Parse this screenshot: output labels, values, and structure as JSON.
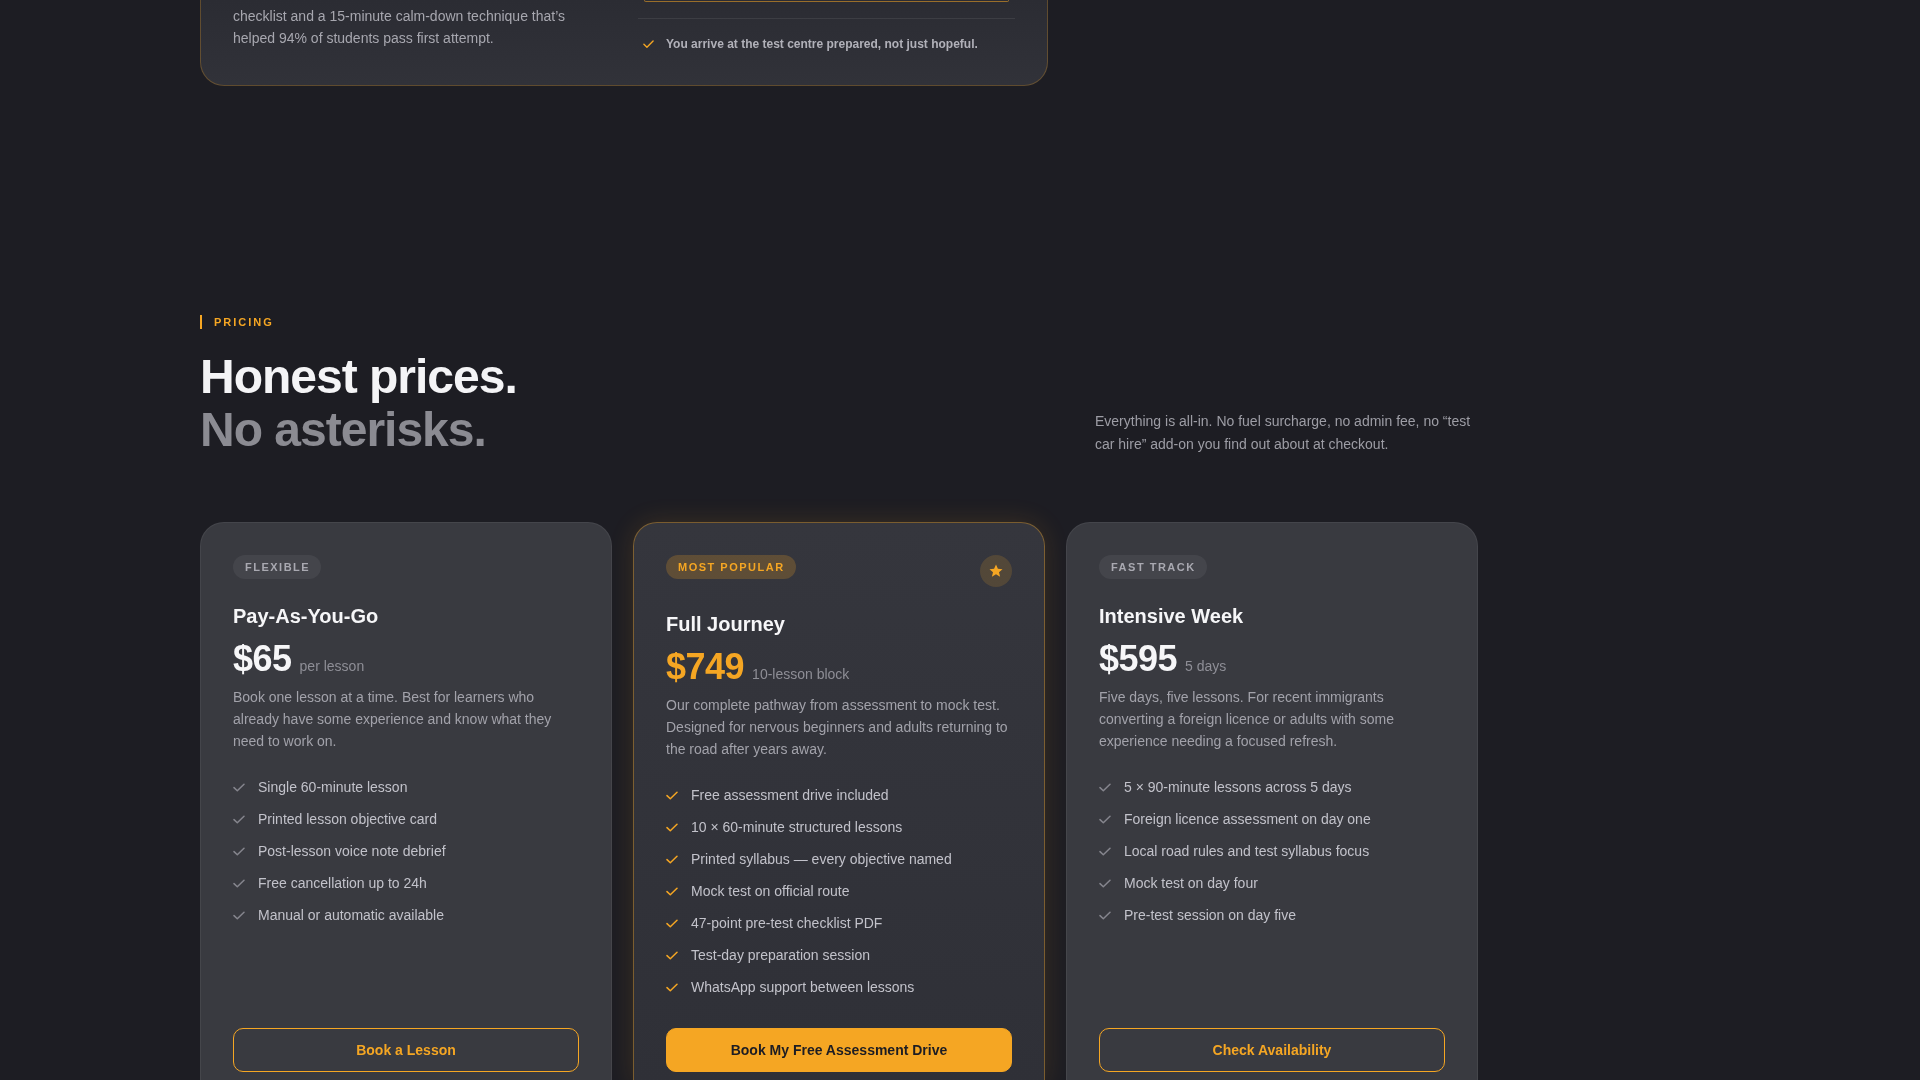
{
  "intro_card": {
    "description": "checklist and a 15-minute calm-down technique that’s helped 94% of students pass first attempt.",
    "promise": "You arrive at the test centre prepared, not just hopeful."
  },
  "pricing": {
    "eyebrow": "PRICING",
    "heading": "Honest prices.",
    "subheading": "No asterisks.",
    "note": "Everything is all-in. No fuel surcharge, no admin fee, no “test car hire” add-on you find out about at checkout."
  },
  "plans": [
    {
      "badge": "FLEXIBLE",
      "featured": false,
      "name": "Pay-As-You-Go",
      "price": "$65",
      "unit": "per lesson",
      "description": "Book one lesson at a time. Best for learners who already have some experience and know what they need to work on.",
      "features": [
        "Single 60-minute lesson",
        "Printed lesson objective card",
        "Post-lesson voice note debrief",
        "Free cancellation up to 24h",
        "Manual or automatic available"
      ],
      "button": "Book a Lesson"
    },
    {
      "badge": "MOST POPULAR",
      "featured": true,
      "name": "Full Journey",
      "price": "$749",
      "unit": "10-lesson block",
      "description": "Our complete pathway from assessment to mock test. Designed for nervous beginners and adults returning to the road after years away.",
      "features": [
        "Free assessment drive included",
        "10 × 60-minute structured lessons",
        "Printed syllabus — every objective named",
        "Mock test on official route",
        "47-point pre-test checklist PDF",
        "Test-day preparation session",
        "WhatsApp support between lessons"
      ],
      "button": "Book My Free Assessment Drive"
    },
    {
      "badge": "FAST TRACK",
      "featured": false,
      "name": "Intensive Week",
      "price": "$595",
      "unit": "5 days",
      "description": "Five days, five lessons. For recent immigrants converting a foreign licence or adults with some experience needing a focused refresh.",
      "features": [
        "5 × 90-minute lessons across 5 days",
        "Foreign licence assessment on day one",
        "Local road rules and test syllabus focus",
        "Mock test on day four",
        "Pre-test session on day five"
      ],
      "button": "Check Availability"
    }
  ]
}
